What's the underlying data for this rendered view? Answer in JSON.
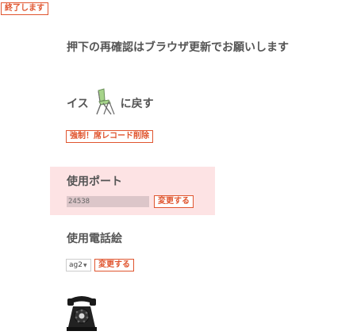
{
  "header": {
    "logout_label": "終了します"
  },
  "notice": "押下の再確認はブラウザ更新でお願いします",
  "return": {
    "text_before": "イス",
    "chair_icon": "folding-chair-icon",
    "text_after": "に戻す"
  },
  "force_delete_label": "強制！席レコード削除",
  "port": {
    "title": "使用ポート",
    "value": "24538",
    "change_label": "変更する"
  },
  "phone_picture": {
    "title": "使用電話絵",
    "selected": "ag2",
    "change_label": "変更する",
    "image_icon": "rotary-phone-icon"
  },
  "colors": {
    "accent": "#e0552f",
    "port_background": "#fde3e4",
    "text": "#555555"
  }
}
